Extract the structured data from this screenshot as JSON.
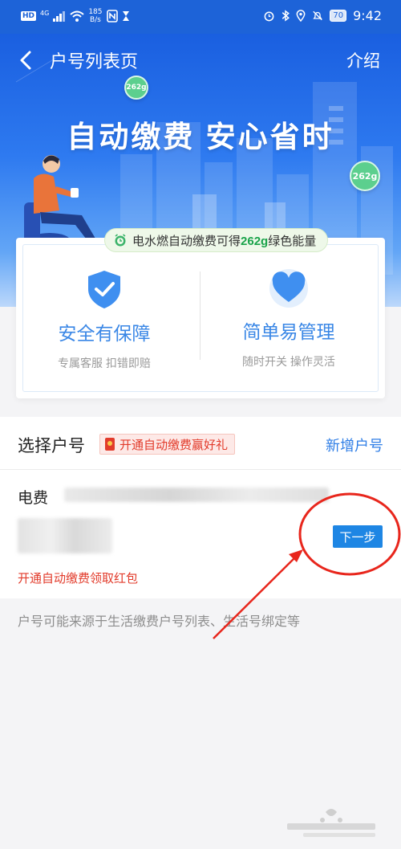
{
  "status_bar": {
    "network_badge": "HD",
    "signal_label": "4G",
    "speed_value": "185",
    "speed_unit": "B/s",
    "battery": "70",
    "time": "9:42"
  },
  "nav": {
    "title": "户号列表页",
    "intro_label": "介绍"
  },
  "hero": {
    "slogan": "自动缴费 安心省时",
    "coin_small": "262g",
    "coin_large": "262g"
  },
  "benefits": {
    "energy_prefix": "电水燃自动缴费可得",
    "energy_amount": "262g",
    "energy_suffix": "绿色能量",
    "features": [
      {
        "title": "安全有保障",
        "subtitle": "专属客服 扣错即赔",
        "icon": "shield-check-icon"
      },
      {
        "title": "简单易管理",
        "subtitle": "随时开关 操作灵活",
        "icon": "heart-icon"
      }
    ]
  },
  "accounts": {
    "section_title": "选择户号",
    "promo_tag": "开通自动缴费赢好礼",
    "add_label": "新增户号",
    "items": [
      {
        "type": "电费",
        "next_label": "下一步",
        "promo": "开通自动缴费领取红包"
      }
    ]
  },
  "footnote": "户号可能来源于生活缴费户号列表、生活号绑定等",
  "colors": {
    "brand_blue": "#1d63d8",
    "link_blue": "#2f7ee6",
    "button_blue": "#1e86e4",
    "promo_red": "#e23b2b",
    "energy_green": "#1aa34a",
    "annotation_red": "#e8261c"
  }
}
